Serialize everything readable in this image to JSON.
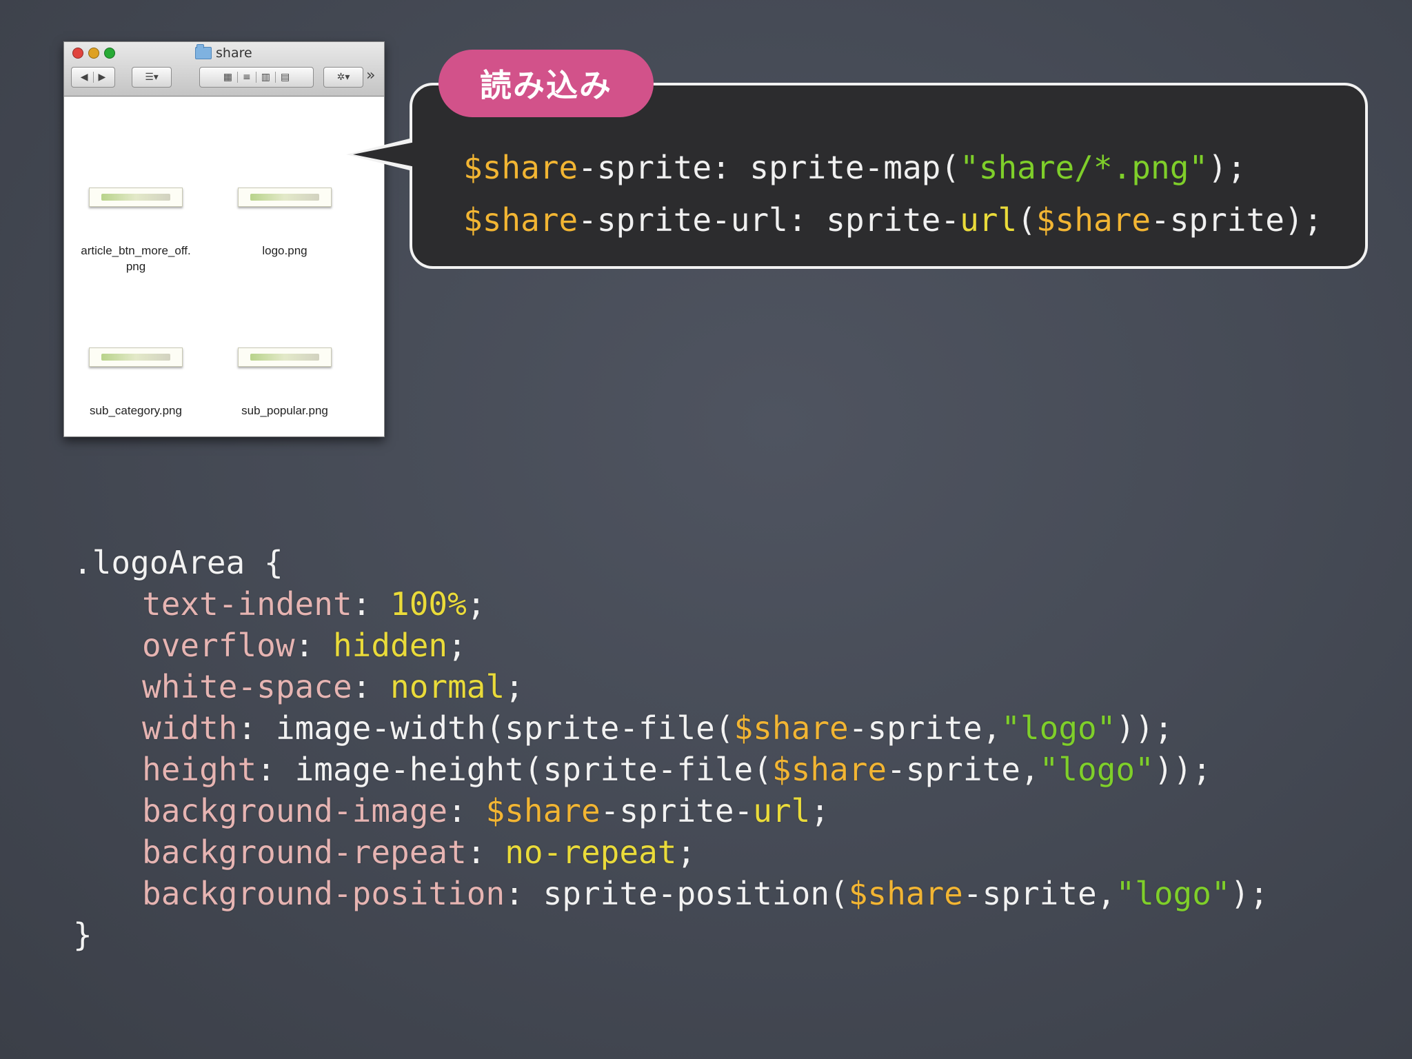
{
  "finder": {
    "title": "share",
    "files": [
      {
        "name": "article_btn_more_off.\npng"
      },
      {
        "name": "logo.png"
      },
      {
        "name": "sub_category.png"
      },
      {
        "name": "sub_popular.png"
      }
    ]
  },
  "callout": {
    "badge": "読み込み",
    "line1": {
      "var": "$share",
      "mid": "-sprite: sprite-map(",
      "str": "\"share/*.png\"",
      "end": ");"
    },
    "line2": {
      "var": "$share",
      "mid": "-sprite-url: sprite-",
      "fn": "url",
      "paren": "(",
      "var2": "$share",
      "end": "-sprite);"
    }
  },
  "code": {
    "selector": ".logoArea {",
    "close": "}",
    "lines": [
      {
        "prop": "text-indent",
        "value": "100%"
      },
      {
        "prop": "overflow",
        "value": "hidden"
      },
      {
        "prop": "white-space",
        "value": "normal"
      },
      {
        "prop": "width",
        "pre": "image-width(sprite-file(",
        "var": "$share",
        "mid": "-sprite,",
        "str": "\"logo\"",
        "end": "));"
      },
      {
        "prop": "height",
        "pre": "image-height(sprite-file(",
        "var": "$share",
        "mid": "-sprite,",
        "str": "\"logo\"",
        "end": "));"
      },
      {
        "prop": "background-image",
        "var": "$share",
        "mid": "-sprite-",
        "kw": "url",
        "end": ";"
      },
      {
        "prop": "background-repeat",
        "value": "no-repeat"
      },
      {
        "prop": "background-position",
        "pre": "sprite-position(",
        "var": "$share",
        "mid": "-sprite,",
        "str": "\"logo\"",
        "end": ");"
      }
    ]
  },
  "colors": {
    "variable": "#f2b533",
    "string": "#7fcf2a",
    "property": "#e6b4b2",
    "keyword": "#eadb3a",
    "badge": "#d2528a"
  }
}
